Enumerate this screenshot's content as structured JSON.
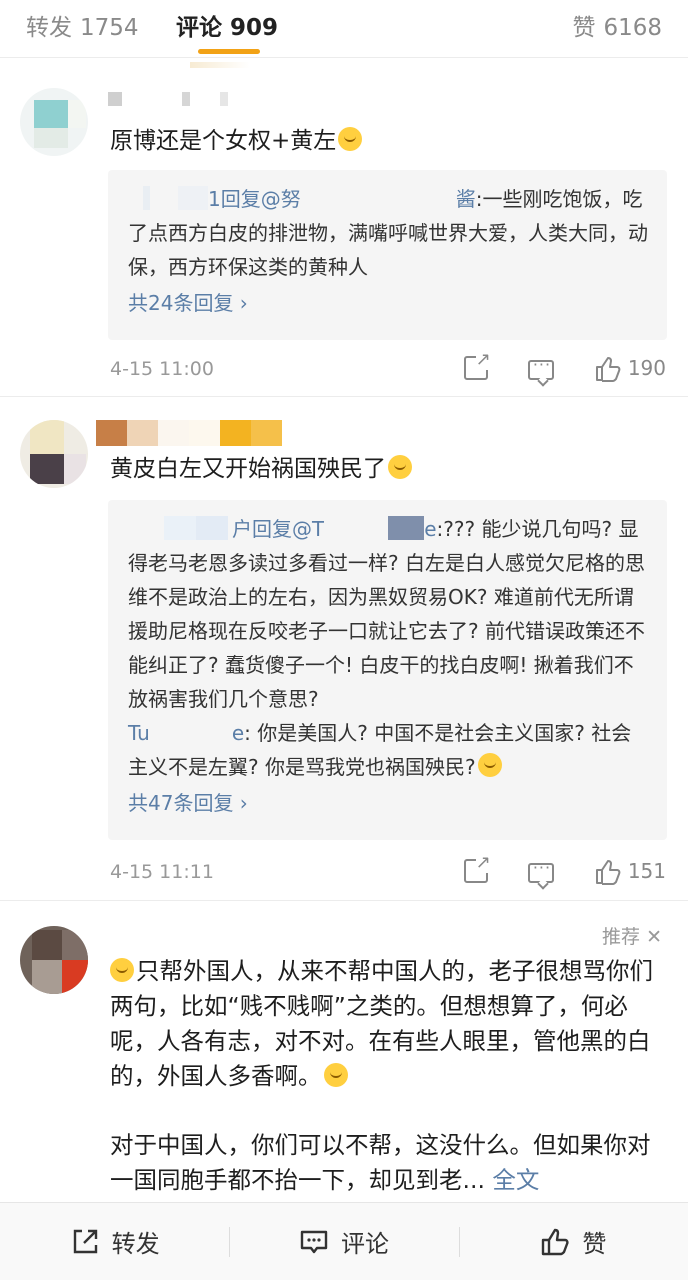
{
  "tabs": {
    "repost": {
      "label": "转发",
      "count": "1754"
    },
    "comment": {
      "label": "评论",
      "count": "909"
    },
    "like": {
      "label": "赞",
      "count": "6168"
    }
  },
  "comments": [
    {
      "text": "原博还是个女权+黄左",
      "replies": [
        {
          "name_prefix": "",
          "name_suffix": "1回复",
          "mention": "@努",
          "mention_end": "酱",
          "text": ":一些刚吃饱饭，吃了点西方白皮的排泄物，满嘴呼喊世界大爱，人类大同，动保，西方环保这类的黄种人"
        }
      ],
      "more_replies": "共24条回复 ›",
      "time": "4-15 11:00",
      "likes": "190"
    },
    {
      "text": "黄皮白左又开始祸国殃民了",
      "replies": [
        {
          "name_suffix": "户回复",
          "mention": "@T",
          "mention_end": "e",
          "text": ":??? 能少说几句吗? 显得老马老恩多读过多看过一样? 白左是白人感觉欠尼格的思维不是政治上的左右，因为黑奴贸易OK? 难道前代无所谓援助尼格现在反咬老子一口就让它去了? 前代错误政策还不能纠正了? 蠢货傻子一个! 白皮干的找白皮啊! 揪着我们不放祸害我们几个意思?"
        },
        {
          "name": "Tu",
          "name_end": "e",
          "text": ": 你是美国人? 中国不是社会主义国家? 社会主义不是左翼? 你是骂我党也祸国殃民?"
        }
      ],
      "more_replies": "共47条回复 ›",
      "time": "4-15 11:11",
      "likes": "151"
    },
    {
      "recommend_label": "推荐",
      "text_p1": "只帮外国人，从来不帮中国人的，老子很想骂你们两句，比如“贱不贱啊”之类的。但想想算了，何必呢，人各有志，对不对。在有些人眼里，管他黑的白的，外国人多香啊。",
      "text_p2": "对于中国人，你们可以不帮，这没什么。但如果你对一国同胞手都不抬一下，却见到老...",
      "read_more": "全文"
    }
  ],
  "bottom": {
    "repost": "转发",
    "comment": "评论",
    "like": "赞"
  },
  "colors": {
    "accent": "#f2a216",
    "link": "#5b7ea7"
  }
}
